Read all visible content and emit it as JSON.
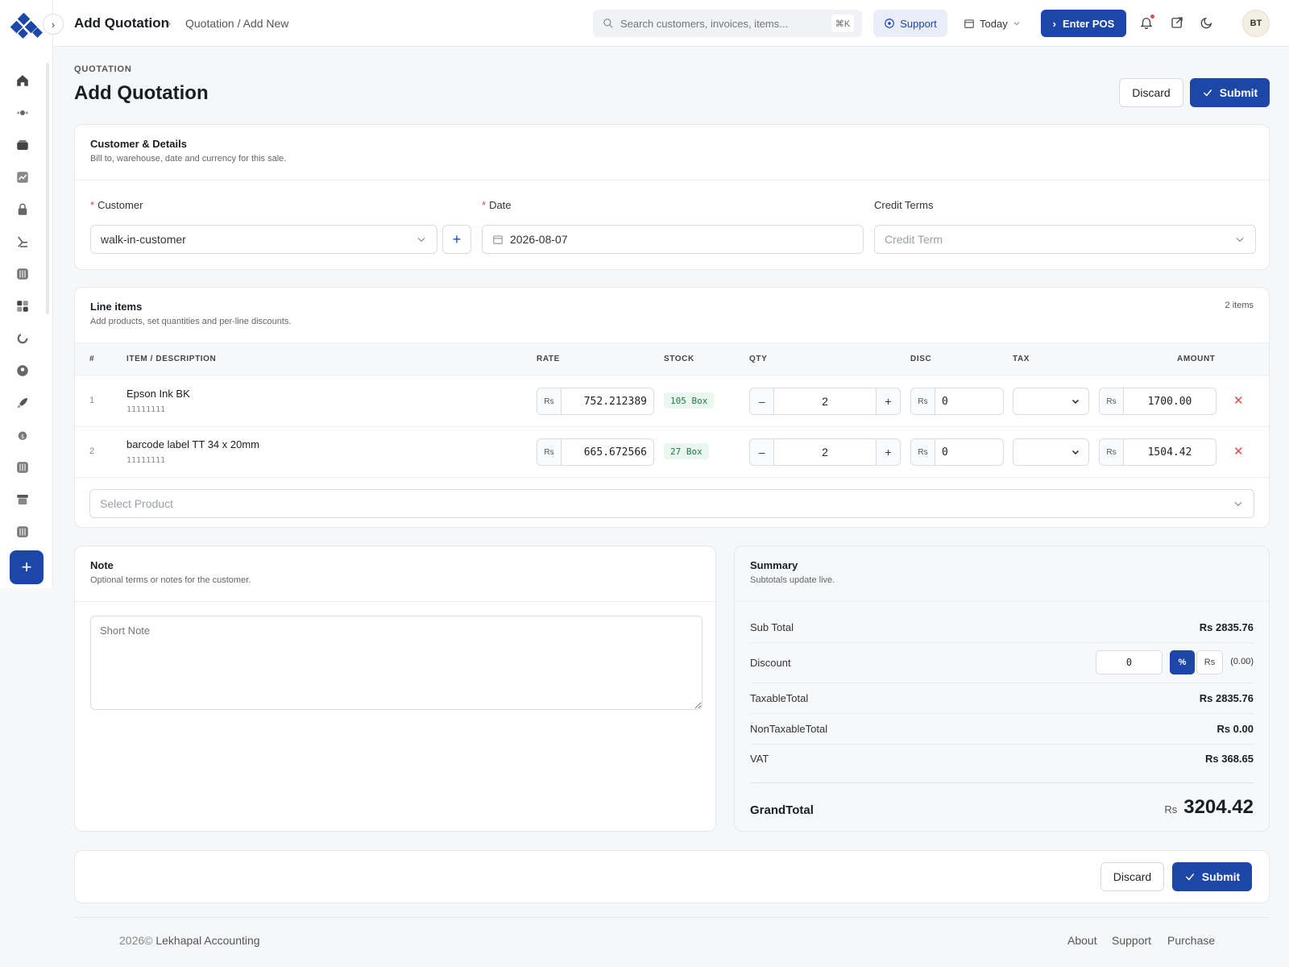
{
  "brand_color": "#1c46a8",
  "header": {
    "title": "Add Quotation",
    "breadcrumb": "Quotation / Add New",
    "search_placeholder": "Search customers, invoices, items...",
    "search_kbd": "⌘K",
    "support_label": "Support",
    "today_label": "Today",
    "pos_label": "Enter POS",
    "avatar_initials": "BT"
  },
  "sidebar": {
    "icons": [
      "home-icon",
      "tag-icon",
      "wallet-icon",
      "chart-icon",
      "lock-icon",
      "scale-icon",
      "sliders-icon",
      "grid-icon",
      "loader-icon",
      "user-icon",
      "rocket-icon",
      "money-icon",
      "sliders-icon-2",
      "archive-icon",
      "sliders-icon-3"
    ]
  },
  "page": {
    "eyebrow": "QUOTATION",
    "title": "Add Quotation",
    "discard_label": "Discard",
    "submit_label": "Submit"
  },
  "customer_card": {
    "title": "Customer & Details",
    "subtitle": "Bill to, warehouse, date and currency for this sale.",
    "customer_label": "Customer",
    "customer_value": "walk-in-customer",
    "date_label": "Date",
    "date_value": "2026-08-07",
    "credit_label": "Credit Terms",
    "credit_placeholder": "Credit Term"
  },
  "line_items": {
    "title": "Line items",
    "subtitle": "Add products, set quantities and per-line discounts.",
    "count_label": "2 items",
    "columns": {
      "num": "#",
      "item": "ITEM / DESCRIPTION",
      "rate": "RATE",
      "stock": "STOCK",
      "qty": "QTY",
      "disc": "DISC",
      "tax": "TAX",
      "amount": "AMOUNT"
    },
    "currency_prefix": "Rs",
    "rows": [
      {
        "num": "1",
        "name": "Epson Ink BK",
        "code": "11111111",
        "rate": "752.212389",
        "stock": "105 Box",
        "qty": "2",
        "disc": "0",
        "amount": "1700.00"
      },
      {
        "num": "2",
        "name": "barcode label TT 34 x 20mm",
        "code": "11111111",
        "rate": "665.672566",
        "stock": "27 Box",
        "qty": "2",
        "disc": "0",
        "amount": "1504.42"
      }
    ],
    "select_product_placeholder": "Select Product"
  },
  "note": {
    "title": "Note",
    "subtitle": "Optional terms or notes for the customer.",
    "placeholder": "Short Note"
  },
  "summary": {
    "title": "Summary",
    "subtitle": "Subtotals update live.",
    "sub_total_label": "Sub Total",
    "sub_total_value": "Rs 2835.76",
    "discount_label": "Discount",
    "discount_value": "0",
    "discount_percent_label": "%",
    "discount_rs_label": "Rs",
    "discount_amount": "(0.00)",
    "taxable_label": "TaxableTotal",
    "taxable_value": "Rs 2835.76",
    "nontaxable_label": "NonTaxableTotal",
    "nontaxable_value": "Rs 0.00",
    "vat_label": "VAT",
    "vat_value": "Rs 368.65",
    "grand_label": "GrandTotal",
    "grand_currency": "Rs",
    "grand_value": "3204.42"
  },
  "footer": {
    "copyright_year": "2026©",
    "copyright_name": "Lekhapal Accounting",
    "links": [
      "About",
      "Support",
      "Purchase"
    ]
  }
}
